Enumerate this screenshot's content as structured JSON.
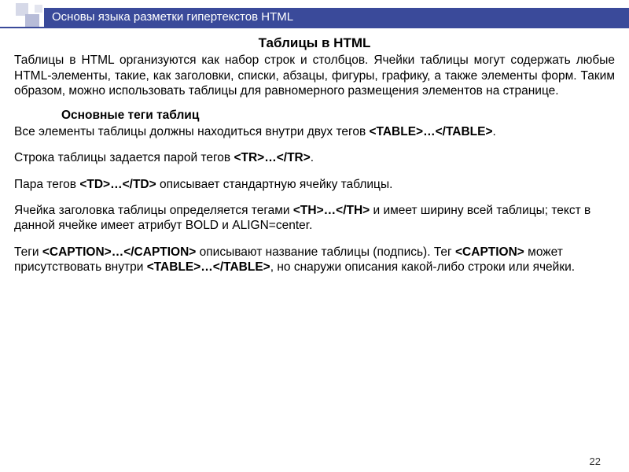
{
  "titleBar": "Основы языка разметки гипертекстов HTML",
  "heading": "Таблицы в HTML",
  "intro": "Таблицы в HTML организуются как набор строк и столбцов. Ячейки таблицы могут содержать любые HTML-элементы, такие, как заголовки, списки, абзацы, фигуры, графику, а также элементы форм. Таким образом, можно использовать таблицы для равномерного размещения элементов на странице.",
  "subHeading": "Основные теги таблиц",
  "p1a": "Все элементы таблицы должны находиться внутри двух тегов ",
  "p1b": "<TABLE>…</TABLE>",
  "p1c": ".",
  "p2a": "Строка таблицы задается парой тегов ",
  "p2b": "<TR>…</TR>",
  "p2c": ".",
  "p3a": "Пара тегов ",
  "p3b": "<TD>…</TD>",
  "p3c": " описывает стандартную ячейку таблицы.",
  "p4a": "Ячейка заголовка таблицы определяется тегами ",
  "p4b": "<TH>…</TH>",
  "p4c": "  и имеет ширину всей таблицы; текст в данной ячейке имеет атрибут BOLD и ALIGN=center.",
  "p5a": "Теги ",
  "p5b": "<CAPTION>…</CAPTION>",
  "p5c": " описывают название таблицы (подпись). Тег ",
  "p5d": "<CAPTION>",
  "p5e": " может присутствовать внутри ",
  "p5f": "<TABLE>…</TABLE>",
  "p5g": ", но снаружи описания какой-либо строки или ячейки.",
  "pageNumber": "22"
}
